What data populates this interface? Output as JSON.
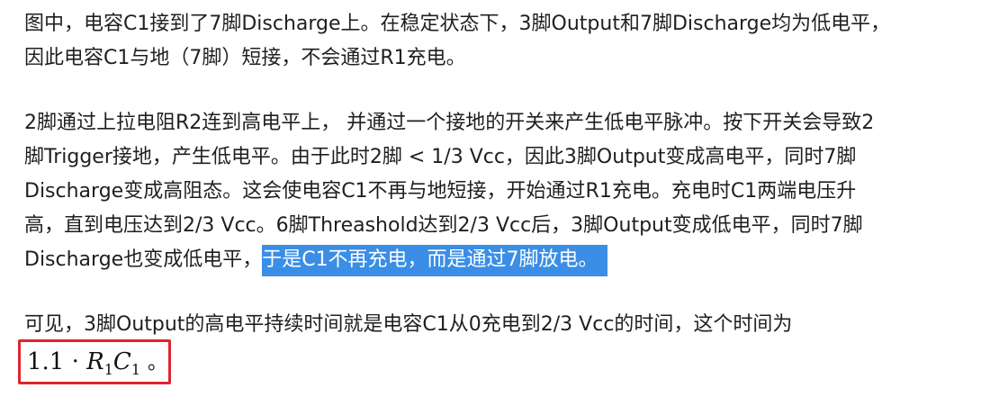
{
  "paragraphs": [
    {
      "lines": [
        "图中，电容C1接到了7脚Discharge上。在稳定状态下，3脚Output和7脚Discharge均为低电平，",
        "因此电容C1与地（7脚）短接，不会通过R1充电。"
      ]
    },
    {
      "lines": [
        "2脚通过上拉电阻R2连到高电平上， 并通过一个接地的开关来产生低电平脉冲。按下开关会导致2",
        "脚Trigger接地，产生低电平。由于此时2脚 < 1/3 Vcc，因此3脚Output变成高电平，同时7脚",
        "Discharge变成高阻态。这会使电容C1不再与地短接，开始通过R1充电。充电时C1两端电压升",
        "高，直到电压达到2/3 Vcc。6脚Threashold达到2/3 Vcc后，3脚Output变成低电平，同时7脚"
      ],
      "last_line_plain": "Discharge也变成低电平，",
      "last_line_selected": "于是C1不再充电，而是通过7脚放电。"
    },
    {
      "lines": [
        "可见，3脚Output的高电平持续时间就是电容C1从0充电到2/3 Vcc的时间，这个时间为"
      ]
    }
  ],
  "formula": {
    "coefficient": "1.1",
    "operator": "·",
    "r_symbol": "R",
    "r_sub": "1",
    "c_symbol": "C",
    "c_sub": "1",
    "trailing": "。"
  },
  "colors": {
    "text": "#1f1f1f",
    "selection_background": "#3a8ee6",
    "selection_text": "#ffffff",
    "annotation_box": "#e0242f"
  }
}
